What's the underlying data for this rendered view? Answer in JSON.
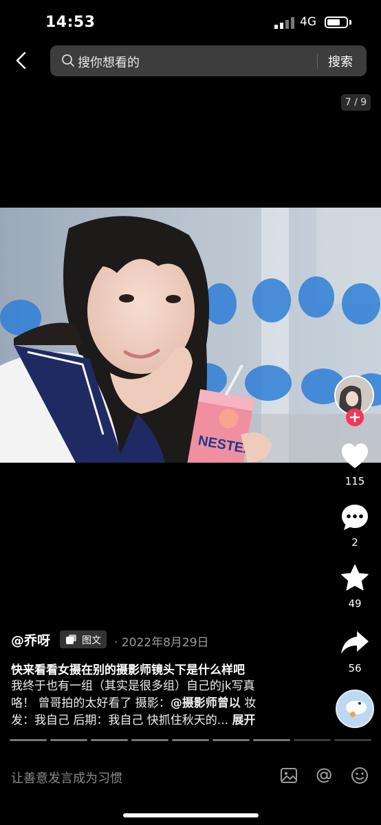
{
  "status": {
    "time": "14:53",
    "network": "4G"
  },
  "header": {
    "search_placeholder": "搜你想看的",
    "search_button": "搜索"
  },
  "gallery": {
    "counter": "7 / 9",
    "current": 7,
    "total": 9
  },
  "actions": {
    "likes": "115",
    "comments": "2",
    "favorites": "49",
    "shares": "56"
  },
  "post": {
    "author": "@乔呀",
    "type_tag": "图文",
    "date": "· 2022年8月29日",
    "title": "快来看看女摄在别的摄影师镜头下是什么样吧",
    "desc_line1": "我终于也有一组（其实是很多组）自己的jk写真",
    "desc_line2_a": "咯！ 曾哥拍的太好看了 摄影：",
    "desc_line2_mention": "@摄影师曾以",
    "desc_line2_b": " 妆",
    "desc_line3": "发：我自己 后期：我自己 快抓住秋天的...",
    "expand": "展开"
  },
  "comment_bar": {
    "placeholder": "让善意发言成为习惯"
  },
  "icons": [
    "back-icon",
    "search-icon",
    "heart-icon",
    "comment-icon",
    "star-icon",
    "share-icon",
    "image-icon",
    "at-icon",
    "emoji-icon"
  ]
}
